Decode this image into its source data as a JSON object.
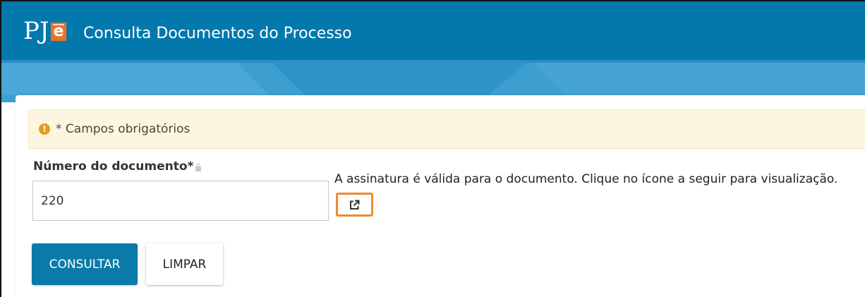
{
  "header": {
    "logo": "PJe",
    "title": "Consulta Documentos do Processo"
  },
  "alert": {
    "icon": "exclamation-circle-icon",
    "text": "* Campos obrigatórios"
  },
  "form": {
    "document_number_label": "Número do documento*",
    "document_number_value": "220",
    "lock_icon": "lock-icon"
  },
  "result": {
    "message": "A assinatura é válida para o documento. Clique no ícone a seguir para visualização.",
    "open_icon": "external-link-icon"
  },
  "buttons": {
    "consultar": "CONSULTAR",
    "limpar": "LIMPAR"
  },
  "colors": {
    "header": "#0278ad",
    "banner": "#3d9fd0",
    "alert_bg": "#fcf6e0",
    "primary_button": "#0a7ba9",
    "highlight": "#f08a2e"
  }
}
